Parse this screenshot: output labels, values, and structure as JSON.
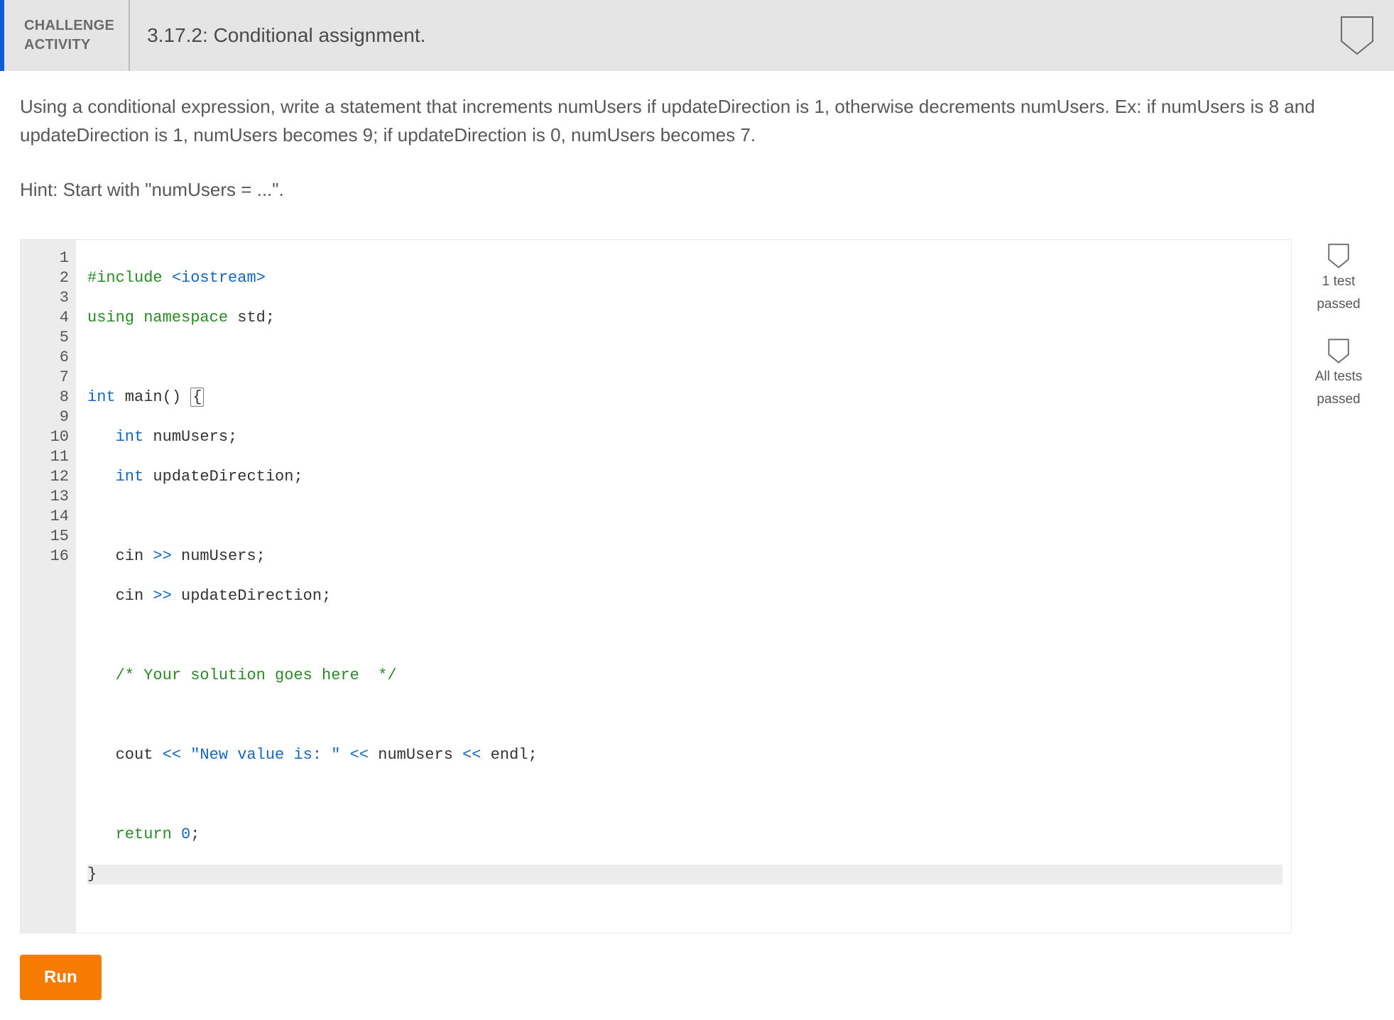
{
  "header": {
    "tag_line1": "CHALLENGE",
    "tag_line2": "ACTIVITY",
    "title": "3.17.2: Conditional assignment."
  },
  "prompt": "Using a conditional expression, write a statement that increments numUsers if updateDirection is 1, otherwise decrements numUsers. Ex: if numUsers is 8 and updateDirection is 1, numUsers becomes 9; if updateDirection is 0, numUsers becomes 7.",
  "hint": "Hint: Start with \"numUsers = ...\".",
  "code": {
    "lines": [
      "#include <iostream>",
      "using namespace std;",
      "",
      "int main() {",
      "   int numUsers;",
      "   int updateDirection;",
      "",
      "   cin >> numUsers;",
      "   cin >> updateDirection;",
      "",
      "   /* Your solution goes here  */",
      "",
      "   cout << \"New value is: \" << numUsers << endl;",
      "",
      "   return 0;",
      "}"
    ]
  },
  "status": {
    "item1_line1": "1 test",
    "item1_line2": "passed",
    "item2_line1": "All tests",
    "item2_line2": "passed"
  },
  "buttons": {
    "run": "Run"
  }
}
